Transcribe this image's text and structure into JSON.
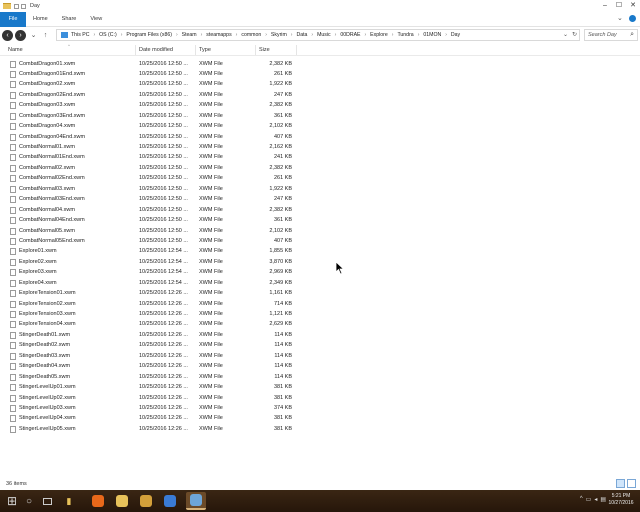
{
  "window": {
    "title": "Day",
    "controls": {
      "minimize": "–",
      "maximize": "☐",
      "close": "✕"
    }
  },
  "ribbon": {
    "tabs": [
      "File",
      "Home",
      "Share",
      "View"
    ],
    "help_icon": "help-icon",
    "expand_icon": "chevron-down-icon"
  },
  "address": {
    "crumbs": [
      "This PC",
      "OS (C:)",
      "Program Files (x86)",
      "Steam",
      "steamapps",
      "common",
      "Skyrim",
      "Data",
      "Music",
      "00DRAE",
      "Explore",
      "Tundra",
      "01MON",
      "Day"
    ],
    "search_placeholder": "Search Day"
  },
  "columns": {
    "name": "Name",
    "date": "Date modified",
    "type": "Type",
    "size": "Size"
  },
  "files": [
    {
      "name": "CombatDragon01.xwm",
      "date": "10/25/2016 12:50 ...",
      "type": "XWM File",
      "size": "2,382 KB"
    },
    {
      "name": "CombatDragon01End.xwm",
      "date": "10/25/2016 12:50 ...",
      "type": "XWM File",
      "size": "261 KB"
    },
    {
      "name": "CombatDragon02.xwm",
      "date": "10/25/2016 12:50 ...",
      "type": "XWM File",
      "size": "1,922 KB"
    },
    {
      "name": "CombatDragon02End.xwm",
      "date": "10/25/2016 12:50 ...",
      "type": "XWM File",
      "size": "247 KB"
    },
    {
      "name": "CombatDragon03.xwm",
      "date": "10/25/2016 12:50 ...",
      "type": "XWM File",
      "size": "2,382 KB"
    },
    {
      "name": "CombatDragon03End.xwm",
      "date": "10/25/2016 12:50 ...",
      "type": "XWM File",
      "size": "361 KB"
    },
    {
      "name": "CombatDragon04.xwm",
      "date": "10/25/2016 12:50 ...",
      "type": "XWM File",
      "size": "2,102 KB"
    },
    {
      "name": "CombatDragon04End.xwm",
      "date": "10/25/2016 12:50 ...",
      "type": "XWM File",
      "size": "407 KB"
    },
    {
      "name": "CombatNormal01.xwm",
      "date": "10/25/2016 12:50 ...",
      "type": "XWM File",
      "size": "2,162 KB"
    },
    {
      "name": "CombatNormal01End.xwm",
      "date": "10/25/2016 12:50 ...",
      "type": "XWM File",
      "size": "241 KB"
    },
    {
      "name": "CombatNormal02.xwm",
      "date": "10/25/2016 12:50 ...",
      "type": "XWM File",
      "size": "2,382 KB"
    },
    {
      "name": "CombatNormal02End.xwm",
      "date": "10/25/2016 12:50 ...",
      "type": "XWM File",
      "size": "261 KB"
    },
    {
      "name": "CombatNormal03.xwm",
      "date": "10/25/2016 12:50 ...",
      "type": "XWM File",
      "size": "1,922 KB"
    },
    {
      "name": "CombatNormal03End.xwm",
      "date": "10/25/2016 12:50 ...",
      "type": "XWM File",
      "size": "247 KB"
    },
    {
      "name": "CombatNormal04.xwm",
      "date": "10/25/2016 12:50 ...",
      "type": "XWM File",
      "size": "2,382 KB"
    },
    {
      "name": "CombatNormal04End.xwm",
      "date": "10/25/2016 12:50 ...",
      "type": "XWM File",
      "size": "361 KB"
    },
    {
      "name": "CombatNormal05.xwm",
      "date": "10/25/2016 12:50 ...",
      "type": "XWM File",
      "size": "2,102 KB"
    },
    {
      "name": "CombatNormal05End.xwm",
      "date": "10/25/2016 12:50 ...",
      "type": "XWM File",
      "size": "407 KB"
    },
    {
      "name": "Explore01.xwm",
      "date": "10/25/2016 12:54 ...",
      "type": "XWM File",
      "size": "1,855 KB"
    },
    {
      "name": "Explore02.xwm",
      "date": "10/25/2016 12:54 ...",
      "type": "XWM File",
      "size": "3,870 KB"
    },
    {
      "name": "Explore03.xwm",
      "date": "10/25/2016 12:54 ...",
      "type": "XWM File",
      "size": "2,969 KB"
    },
    {
      "name": "Explore04.xwm",
      "date": "10/25/2016 12:54 ...",
      "type": "XWM File",
      "size": "2,349 KB"
    },
    {
      "name": "ExploreTension01.xwm",
      "date": "10/25/2016 12:26 ...",
      "type": "XWM File",
      "size": "1,161 KB"
    },
    {
      "name": "ExploreTension02.xwm",
      "date": "10/25/2016 12:26 ...",
      "type": "XWM File",
      "size": "714 KB"
    },
    {
      "name": "ExploreTension03.xwm",
      "date": "10/25/2016 12:26 ...",
      "type": "XWM File",
      "size": "1,121 KB"
    },
    {
      "name": "ExploreTension04.xwm",
      "date": "10/25/2016 12:26 ...",
      "type": "XWM File",
      "size": "2,629 KB"
    },
    {
      "name": "StingerDeath01.xwm",
      "date": "10/25/2016 12:26 ...",
      "type": "XWM File",
      "size": "114 KB"
    },
    {
      "name": "StingerDeath02.xwm",
      "date": "10/25/2016 12:26 ...",
      "type": "XWM File",
      "size": "114 KB"
    },
    {
      "name": "StingerDeath03.xwm",
      "date": "10/25/2016 12:26 ...",
      "type": "XWM File",
      "size": "114 KB"
    },
    {
      "name": "StingerDeath04.xwm",
      "date": "10/25/2016 12:26 ...",
      "type": "XWM File",
      "size": "114 KB"
    },
    {
      "name": "StingerDeath05.xwm",
      "date": "10/25/2016 12:26 ...",
      "type": "XWM File",
      "size": "114 KB"
    },
    {
      "name": "StingerLevelUp01.xwm",
      "date": "10/25/2016 12:26 ...",
      "type": "XWM File",
      "size": "381 KB"
    },
    {
      "name": "StingerLevelUp02.xwm",
      "date": "10/25/2016 12:26 ...",
      "type": "XWM File",
      "size": "381 KB"
    },
    {
      "name": "StingerLevelUp03.xwm",
      "date": "10/25/2016 12:26 ...",
      "type": "XWM File",
      "size": "374 KB"
    },
    {
      "name": "StingerLevelUp04.xwm",
      "date": "10/25/2016 12:26 ...",
      "type": "XWM File",
      "size": "381 KB"
    },
    {
      "name": "StingerLevelUp05.xwm",
      "date": "10/25/2016 12:26 ...",
      "type": "XWM File",
      "size": "381 KB"
    }
  ],
  "status": {
    "item_count": "36 items"
  },
  "taskbar": {
    "clock_time": "5:21 PM",
    "clock_date": "10/27/2016",
    "apps": [
      {
        "icon": "firefox-icon",
        "color": "#e8681a"
      },
      {
        "icon": "file-explorer-icon",
        "color": "#e8c25a"
      },
      {
        "icon": "media-player-icon",
        "color": "#d4a03a"
      },
      {
        "icon": "windows-store-icon",
        "color": "#3a7bd5"
      },
      {
        "icon": "explorer-window-icon",
        "color": "#6ea6d8"
      }
    ]
  },
  "colors": {
    "accent": "#1979ca",
    "taskbar": "#2e1a0e"
  }
}
